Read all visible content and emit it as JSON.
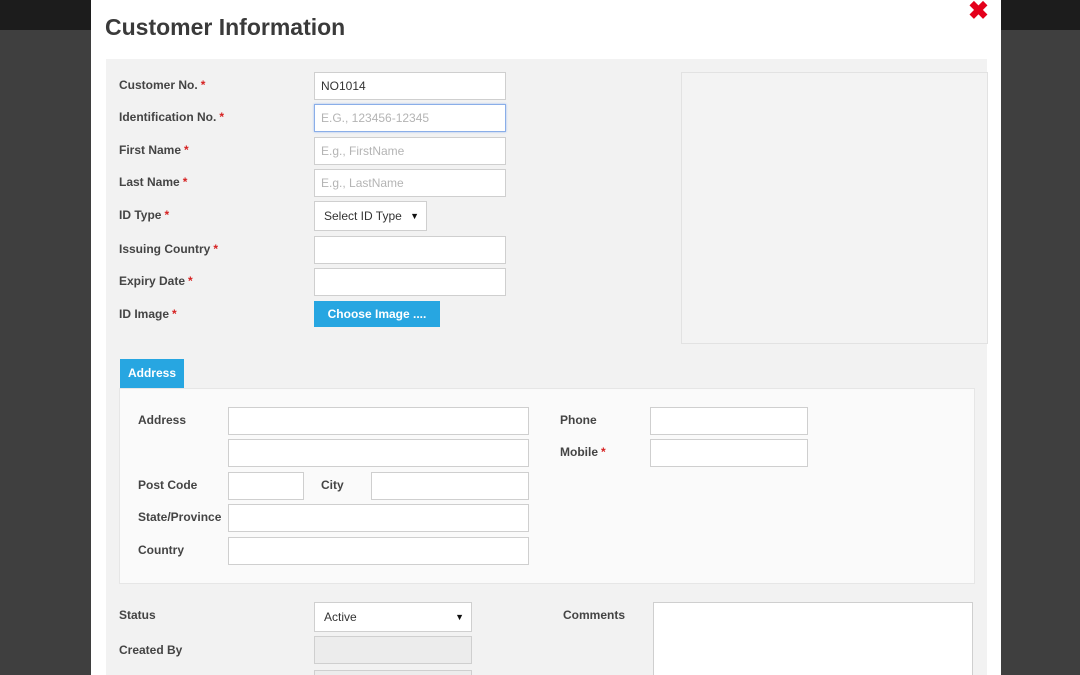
{
  "modal": {
    "title": "Customer Information"
  },
  "identity": {
    "customer_no": {
      "label": "Customer No.",
      "value": "NO1014"
    },
    "identification_no": {
      "label": "Identification No.",
      "placeholder": "E.G., 123456-12345"
    },
    "first_name": {
      "label": "First Name",
      "placeholder": "E.g., FirstName"
    },
    "last_name": {
      "label": "Last Name",
      "placeholder": "E.g., LastName"
    },
    "id_type": {
      "label": "ID Type",
      "selected": "Select ID Type"
    },
    "issuing_country": {
      "label": "Issuing Country"
    },
    "expiry_date": {
      "label": "Expiry Date"
    },
    "id_image": {
      "label": "ID Image",
      "button": "Choose Image ...."
    }
  },
  "address": {
    "tab_label": "Address",
    "address_label": "Address",
    "post_code_label": "Post Code",
    "city_label": "City",
    "state_label": "State/Province",
    "country_label": "Country",
    "phone_label": "Phone",
    "mobile_label": "Mobile"
  },
  "meta": {
    "status_label": "Status",
    "status_selected": "Active",
    "created_by_label": "Created By",
    "comments_label": "Comments"
  },
  "required_mark": "*"
}
